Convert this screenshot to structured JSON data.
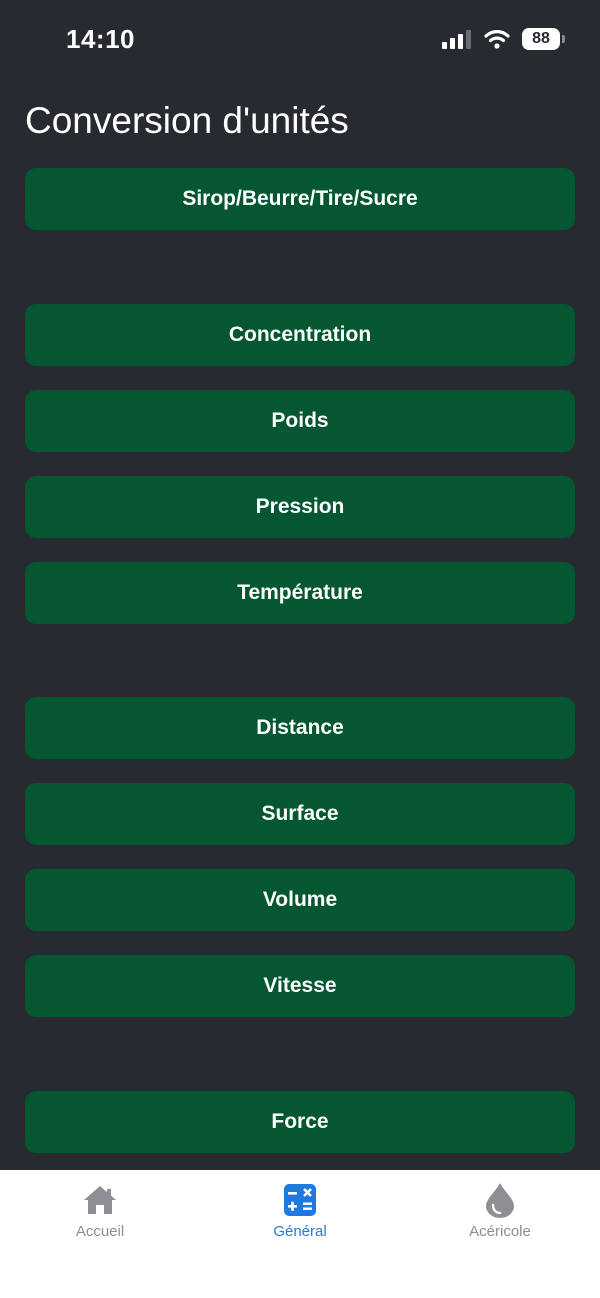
{
  "status_bar": {
    "time": "14:10",
    "battery": "88"
  },
  "page": {
    "title": "Conversion d'unités"
  },
  "buttons": [
    {
      "label": "Sirop/Beurre/Tire/Sucre"
    },
    {
      "label": "Concentration"
    },
    {
      "label": "Poids"
    },
    {
      "label": "Pression"
    },
    {
      "label": "Température"
    },
    {
      "label": "Distance"
    },
    {
      "label": "Surface"
    },
    {
      "label": "Volume"
    },
    {
      "label": "Vitesse"
    },
    {
      "label": "Force"
    }
  ],
  "tabs": [
    {
      "label": "Accueil",
      "icon": "home-icon"
    },
    {
      "label": "Général",
      "icon": "calculator-icon",
      "active": true
    },
    {
      "label": "Acéricole",
      "icon": "drop-icon"
    }
  ],
  "colors": {
    "background": "#282a31",
    "button": "#055731",
    "active_tab": "#1f7ae0",
    "inactive_tab": "#8e8e93"
  }
}
